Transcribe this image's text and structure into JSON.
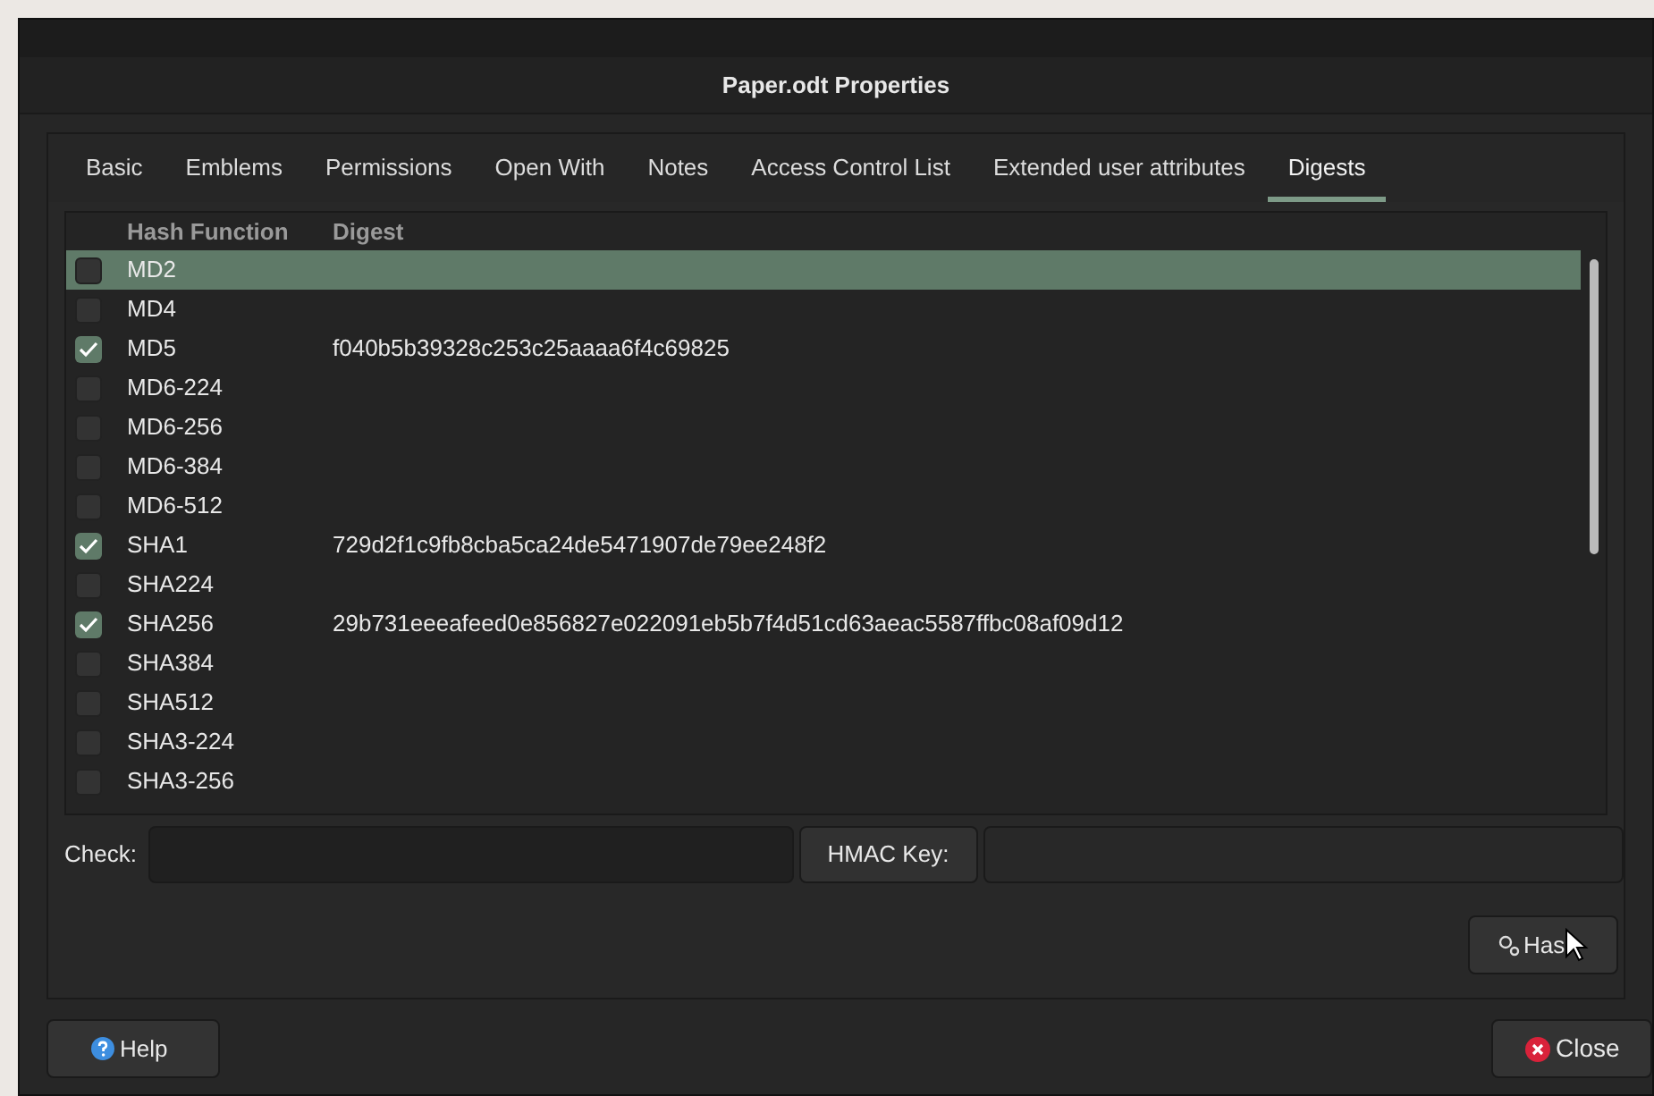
{
  "window": {
    "title": "Paper.odt Properties"
  },
  "tabs": [
    {
      "label": "Basic",
      "selected": false
    },
    {
      "label": "Emblems",
      "selected": false
    },
    {
      "label": "Permissions",
      "selected": false
    },
    {
      "label": "Open With",
      "selected": false
    },
    {
      "label": "Notes",
      "selected": false
    },
    {
      "label": "Access Control List",
      "selected": false
    },
    {
      "label": "Extended user attributes",
      "selected": false
    },
    {
      "label": "Digests",
      "selected": true
    }
  ],
  "table": {
    "columns": [
      "Hash Function",
      "Digest"
    ],
    "rows": [
      {
        "name": "MD2",
        "checked": false,
        "selected": true
      },
      {
        "name": "MD4",
        "checked": false,
        "selected": false
      },
      {
        "name": "MD5",
        "checked": true,
        "selected": false,
        "digest": "f040b5b39328c253c25aaaa6f4c69825"
      },
      {
        "name": "MD6-224",
        "checked": false,
        "selected": false
      },
      {
        "name": "MD6-256",
        "checked": false,
        "selected": false
      },
      {
        "name": "MD6-384",
        "checked": false,
        "selected": false
      },
      {
        "name": "MD6-512",
        "checked": false,
        "selected": false
      },
      {
        "name": "SHA1",
        "checked": true,
        "selected": false,
        "digest": "729d2f1c9fb8cba5ca24de5471907de79ee248f2"
      },
      {
        "name": "SHA224",
        "checked": false,
        "selected": false
      },
      {
        "name": "SHA256",
        "checked": true,
        "selected": false,
        "digest": "29b731eeeafeed0e856827e022091eb5b7f4d51cd63aeac5587ffbc08af09d12"
      },
      {
        "name": "SHA384",
        "checked": false,
        "selected": false
      },
      {
        "name": "SHA512",
        "checked": false,
        "selected": false
      },
      {
        "name": "SHA3-224",
        "checked": false,
        "selected": false
      },
      {
        "name": "SHA3-256",
        "checked": false,
        "selected": false
      }
    ]
  },
  "check": {
    "label": "Check:"
  },
  "hmac": {
    "label": "HMAC Key:"
  },
  "hash_button": {
    "label": "Has"
  },
  "buttons": {
    "help": "Help",
    "close": "Close"
  }
}
